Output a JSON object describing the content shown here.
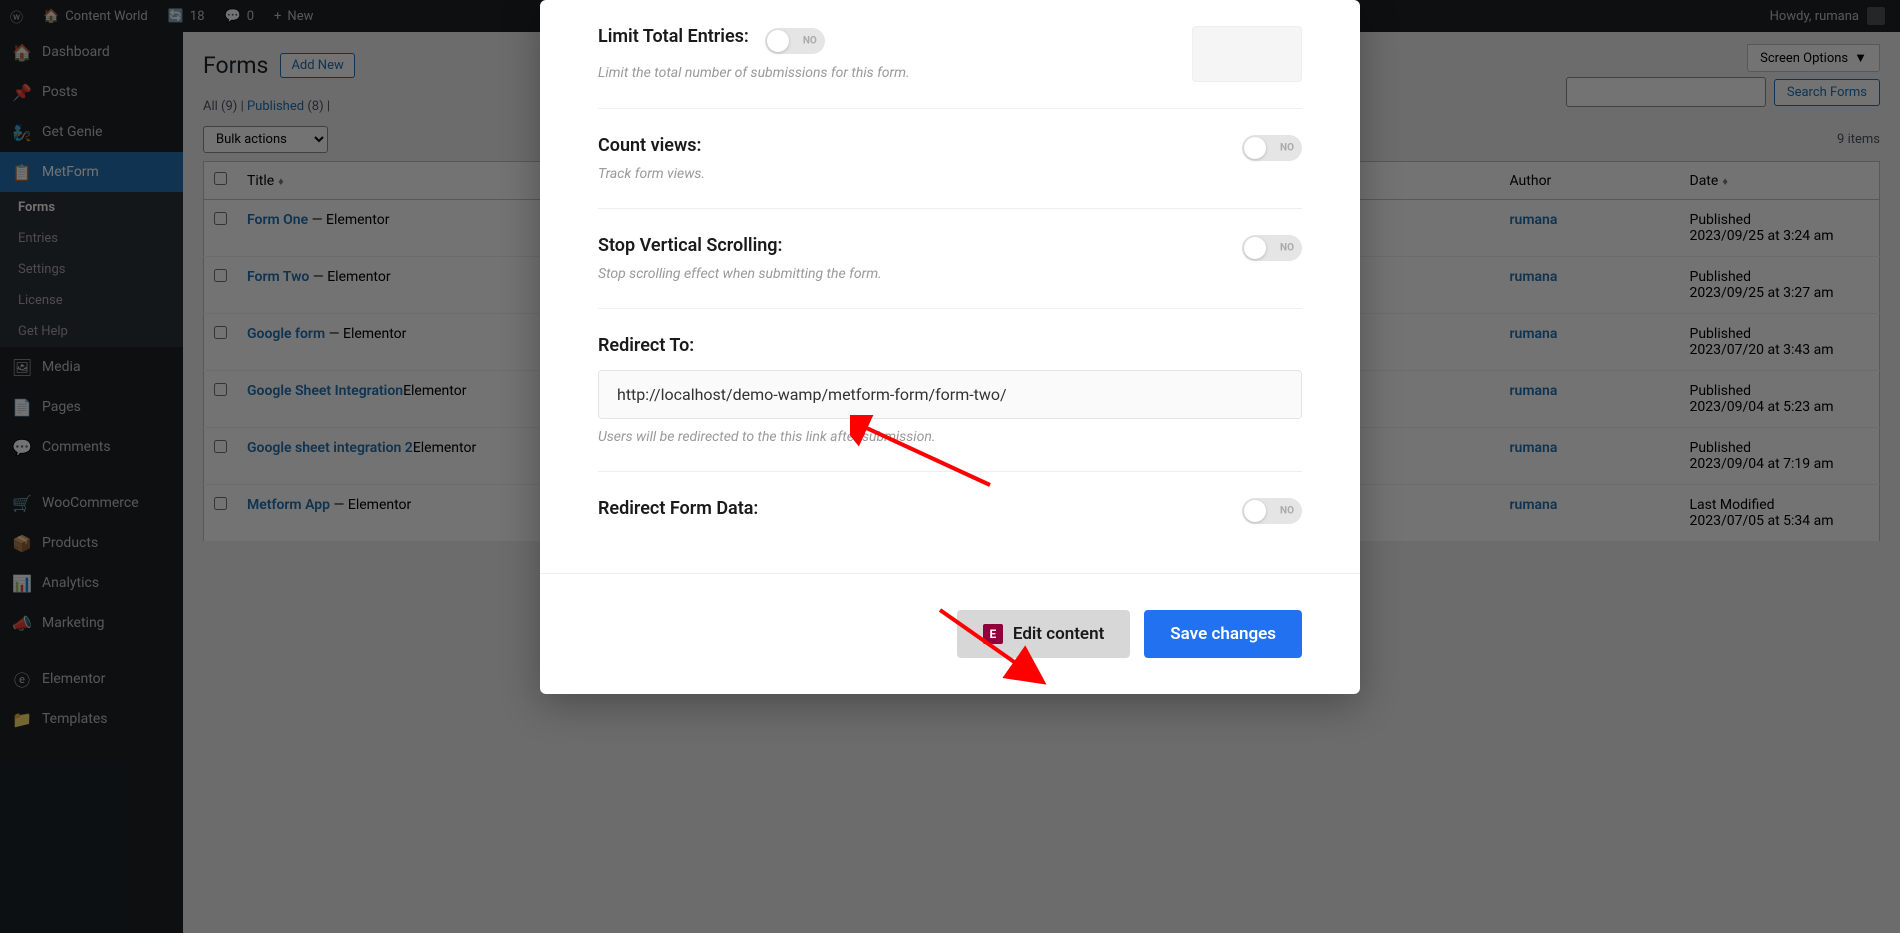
{
  "adminbar": {
    "site_name": "Content World",
    "updates_count": "18",
    "comments_count": "0",
    "new_label": "New",
    "howdy": "Howdy, rumana"
  },
  "sidebar": {
    "dashboard": "Dashboard",
    "posts": "Posts",
    "get_genie": "Get Genie",
    "metform": "MetForm",
    "metform_sub": {
      "forms": "Forms",
      "entries": "Entries",
      "settings": "Settings",
      "license": "License",
      "get_help": "Get Help"
    },
    "media": "Media",
    "pages": "Pages",
    "comments": "Comments",
    "woocommerce": "WooCommerce",
    "products": "Products",
    "analytics": "Analytics",
    "marketing": "Marketing",
    "elementor": "Elementor",
    "templates": "Templates"
  },
  "page": {
    "title": "Forms",
    "add_new": "Add New",
    "screen_options": "Screen Options",
    "search_forms": "Search Forms",
    "filters": {
      "all": "All",
      "all_count": "(9)",
      "published": "Published",
      "published_count": "(8)",
      "sep": "  |  "
    },
    "bulk_actions": "Bulk actions",
    "items_count": "9 items"
  },
  "table": {
    "title_col": "Title",
    "author_col": "Author",
    "date_col": "Date",
    "rows": [
      {
        "title": "Form One",
        "suffix": " — Elementor",
        "author": "rumana",
        "status": "Published",
        "date": "2023/09/25 at 3:24 am"
      },
      {
        "title": "Form Two",
        "suffix": " — Elementor",
        "author": "rumana",
        "status": "Published",
        "date": "2023/09/25 at 3:27 am"
      },
      {
        "title": "Google form",
        "suffix": " — Elementor",
        "author": "rumana",
        "status": "Published",
        "date": "2023/07/20 at 3:43 am"
      },
      {
        "title": "Google Sheet Integration",
        "suffix": "Elementor",
        "author": "rumana",
        "status": "Published",
        "date": "2023/09/04 at 5:23 am"
      },
      {
        "title": "Google sheet integration 2",
        "suffix": "Elementor",
        "author": "rumana",
        "status": "Published",
        "date": "2023/09/04 at 7:19 am"
      },
      {
        "title": "Metform App",
        "suffix": " — Elementor",
        "author": "rumana",
        "status": "Last Modified",
        "date": "2023/07/05 at 5:34 am"
      }
    ]
  },
  "modal": {
    "limit_entries": {
      "label": "Limit Total Entries:",
      "help": "Limit the total number of submissions for this form.",
      "toggle": "NO"
    },
    "count_views": {
      "label": "Count views:",
      "help": "Track form views.",
      "toggle": "NO"
    },
    "stop_scroll": {
      "label": "Stop Vertical Scrolling:",
      "help": "Stop scrolling effect when submitting the form.",
      "toggle": "NO"
    },
    "redirect_to": {
      "label": "Redirect To:",
      "value": "http://localhost/demo-wamp/metform-form/form-two/",
      "help": "Users will be redirected to the this link after submission."
    },
    "redirect_data": {
      "label": "Redirect Form Data:",
      "toggle": "NO"
    },
    "edit_content": "Edit content",
    "save_changes": "Save changes"
  }
}
